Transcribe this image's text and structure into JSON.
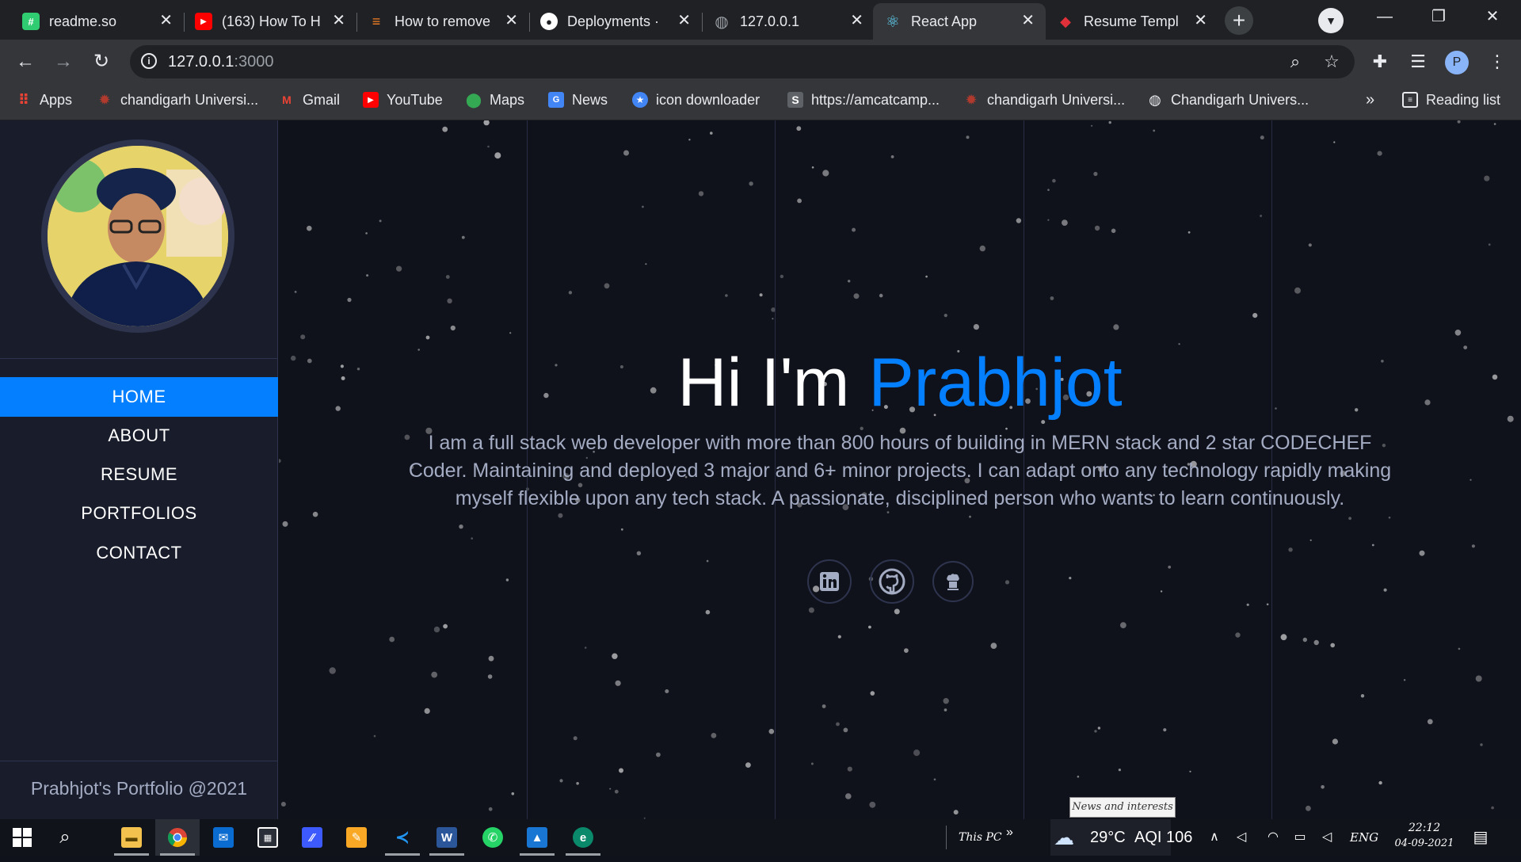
{
  "tabs": [
    {
      "title": "readme.so",
      "favicon_color": "#2fcc71",
      "favicon_glyph": "#"
    },
    {
      "title": "(163) How To H",
      "favicon_color": "#ff0000",
      "favicon_glyph": "▶"
    },
    {
      "title": "How to remove",
      "favicon_color": "#f48024",
      "favicon_glyph": "≡"
    },
    {
      "title": "Deployments ·",
      "favicon_color": "#ffffff",
      "favicon_glyph": "●"
    },
    {
      "title": "127.0.0.1",
      "favicon_color": "#9aa0a6",
      "favicon_glyph": "◍"
    },
    {
      "title": "React App",
      "favicon_color": "#61dafb",
      "favicon_glyph": "⚛"
    },
    {
      "title": "Resume Templ",
      "favicon_color": "#e0303a",
      "favicon_glyph": "◆"
    }
  ],
  "active_tab_index": 5,
  "address": {
    "host": "127.0.0.1",
    "port": ":3000"
  },
  "bookmarks": [
    {
      "label": "Apps",
      "icon": "apps-grid-icon",
      "color": "#ea4335"
    },
    {
      "label": "chandigarh Universi...",
      "icon": "university-icon",
      "color": "#b03a2e"
    },
    {
      "label": "Gmail",
      "icon": "gmail-icon",
      "color": "#ea4335"
    },
    {
      "label": "YouTube",
      "icon": "youtube-icon",
      "color": "#ff0000"
    },
    {
      "label": "Maps",
      "icon": "maps-pin-icon",
      "color": "#34a853"
    },
    {
      "label": "News",
      "icon": "google-news-icon",
      "color": "#4285f4"
    },
    {
      "label": "icon downloader",
      "icon": "star-badge-icon",
      "color": "#4285f4"
    },
    {
      "label": "https://amcatcamp...",
      "icon": "s-letter-icon",
      "color": "#5f6368"
    },
    {
      "label": "chandigarh Universi...",
      "icon": "university-icon",
      "color": "#b03a2e"
    },
    {
      "label": "Chandigarh Univers...",
      "icon": "globe-icon",
      "color": "#9aa0a6"
    }
  ],
  "bookmarks_overflow": "»",
  "reading_list": "Reading list",
  "sidebar": {
    "nav": [
      "HOME",
      "ABOUT",
      "RESUME",
      "PORTFOLIOS",
      "CONTACT"
    ],
    "active_nav_index": 0,
    "footer": "Prabhjot's Portfolio @2021"
  },
  "hero": {
    "greeting": "Hi I'm ",
    "name": "Prabhjot",
    "description": "I am a full stack web developer with more than 800 hours of building in MERN stack and 2 star CODECHEF Coder. Maintaining and deployed 3 major and 6+ minor projects. I can adapt onto any technology rapidly making myself flexible upon any tech stack. A passionate, disciplined person who wants to learn continuously.",
    "socials": [
      "linkedin-icon",
      "github-icon",
      "codechef-icon"
    ]
  },
  "colors": {
    "accent": "#037fff",
    "sidebar_bg": "#191d2b",
    "page_bg": "#10121b",
    "body_text": "#a4acc4"
  },
  "tooltip": "News and interests",
  "taskbar": {
    "this_pc": "This PC",
    "weather": "29°C",
    "aqi": "AQI 106",
    "language": "ENG",
    "time": "22:12",
    "date": "04-09-2021",
    "apps": [
      "file-explorer-icon",
      "chrome-icon",
      "mail-icon",
      "store-icon",
      "visual-studio-icon",
      "notes-icon",
      "vscode-icon",
      "word-icon",
      "whatsapp-icon",
      "photos-icon",
      "edge-icon"
    ]
  }
}
